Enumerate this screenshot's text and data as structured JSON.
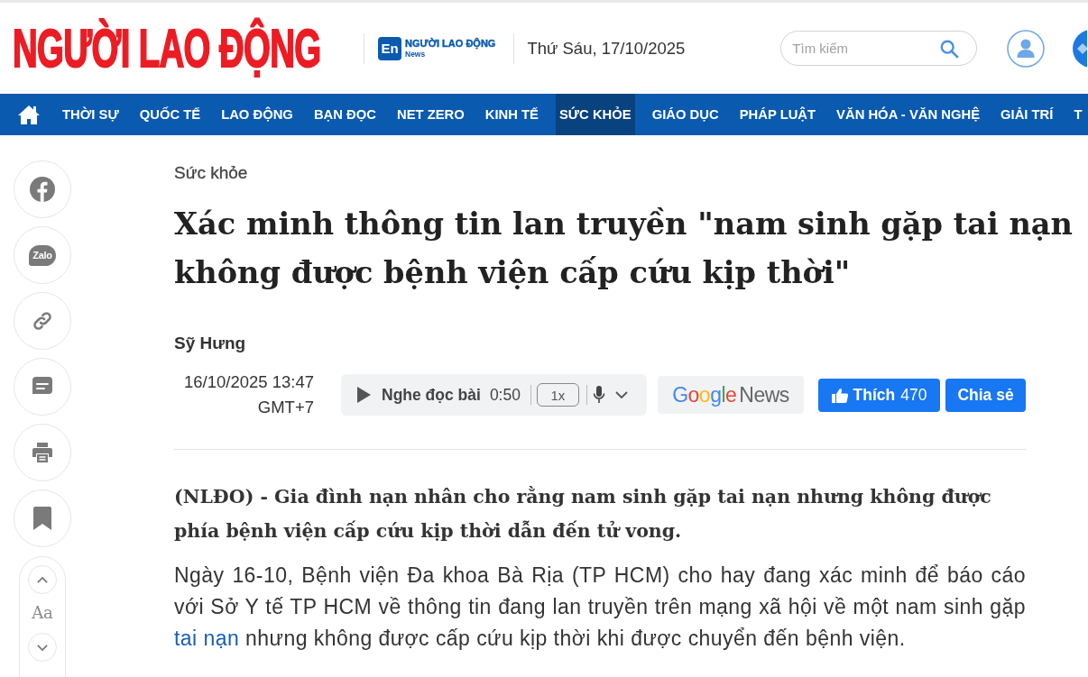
{
  "header": {
    "logo": "NGƯỜI LAO ĐỘNG",
    "en_logo": {
      "badge": "En",
      "name": "NGƯỜI LAO ĐỘNG",
      "sub": "News"
    },
    "date": "Thứ Sáu, 17/10/2025",
    "search": {
      "placeholder": "Tìm kiếm"
    }
  },
  "nav": {
    "items": [
      {
        "label": "THỜI SỰ",
        "selected": false
      },
      {
        "label": "QUỐC TẾ",
        "selected": false
      },
      {
        "label": "LAO ĐỘNG",
        "selected": false
      },
      {
        "label": "BẠN ĐỌC",
        "selected": false
      },
      {
        "label": "NET ZERO",
        "selected": false
      },
      {
        "label": "KINH TẾ",
        "selected": false
      },
      {
        "label": "SỨC KHỎE",
        "selected": true
      },
      {
        "label": "GIÁO DỤC",
        "selected": false
      },
      {
        "label": "PHÁP LUẬT",
        "selected": false
      },
      {
        "label": "VĂN HÓA - VĂN NGHỆ",
        "selected": false
      },
      {
        "label": "GIẢI TRÍ",
        "selected": false
      },
      {
        "label": "T",
        "selected": false
      }
    ]
  },
  "share_bar": {
    "items": [
      {
        "kind": "facebook"
      },
      {
        "kind": "zalo",
        "label": "Zalo"
      },
      {
        "kind": "link"
      },
      {
        "kind": "comment"
      },
      {
        "kind": "print"
      },
      {
        "kind": "bookmark"
      }
    ],
    "font_size": {
      "label": "Aa"
    }
  },
  "article": {
    "category": "Sức khỏe",
    "title": "Xác minh thông tin lan truyền \"nam sinh gặp tai nạn không được bệnh viện cấp cứu kịp thời\"",
    "author": "Sỹ Hưng",
    "published": {
      "date": "16/10/2025 13:47",
      "timezone": "GMT+7"
    },
    "audio": {
      "label": "Nghe đọc bài",
      "duration": "0:50",
      "speed": "1x"
    },
    "google_news": {
      "brand": "Google",
      "label": "News"
    },
    "like": {
      "label": "Thích",
      "count": "470"
    },
    "share": {
      "label": "Chia sẻ"
    },
    "lead": "(NLĐO) - Gia đình nạn nhân cho rằng nam sinh gặp tai nạn nhưng không được phía bệnh viện cấp cứu kịp thời dẫn đến tử vong.",
    "body": [
      {
        "kind": "text",
        "text": "Ngày 16-10, Bệnh viện Đa khoa Bà Rịa (TP HCM) cho hay đang xác minh để báo cáo với Sở Y tế TP HCM về thông tin đang lan truyền trên mạng xã hội về một nam sinh gặp "
      },
      {
        "kind": "link",
        "text": "tai nạn"
      },
      {
        "kind": "text",
        "text": " nhưng không được cấp cứu kịp thời khi được chuyển đến bệnh viện."
      }
    ]
  }
}
